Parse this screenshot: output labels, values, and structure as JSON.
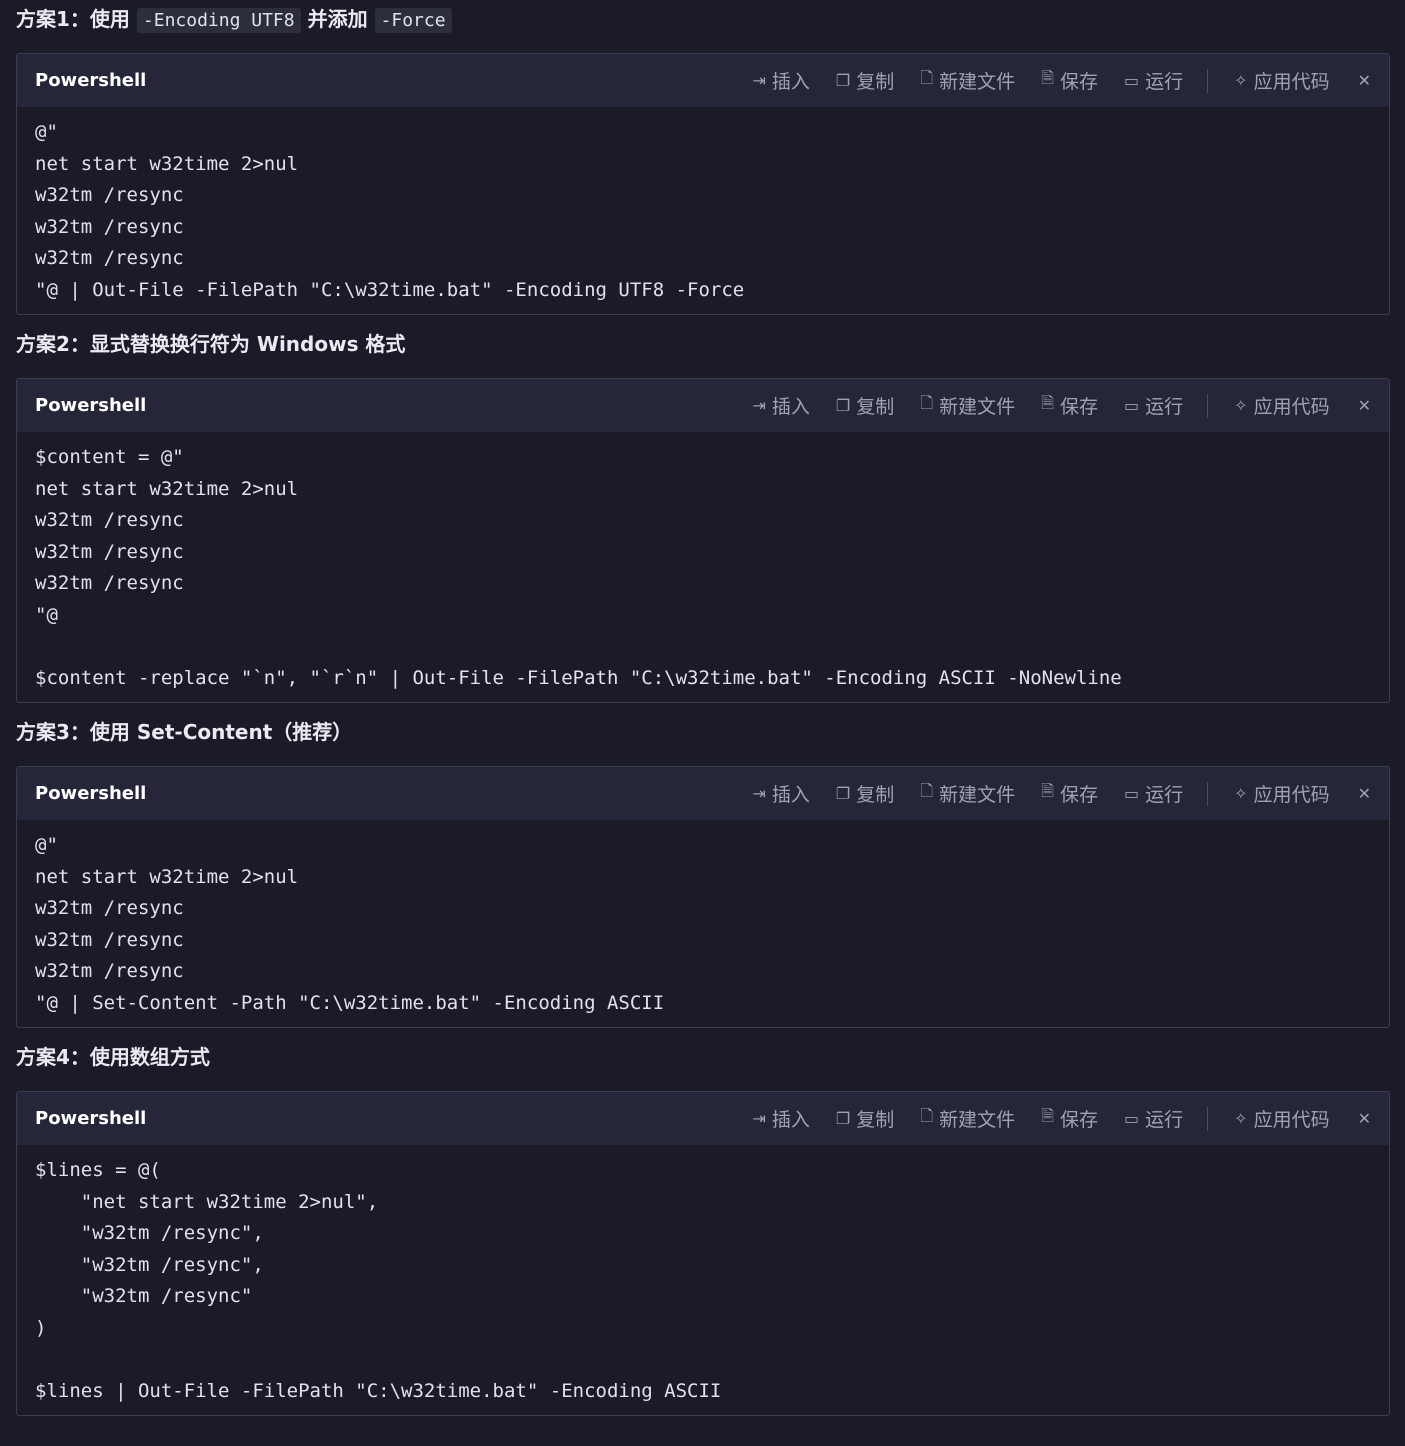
{
  "sections": [
    {
      "heading_parts": [
        {
          "t": "方案1：使用 ",
          "code": false
        },
        {
          "t": "-Encoding UTF8",
          "code": true
        },
        {
          "t": " 并添加 ",
          "code": false
        },
        {
          "t": "-Force",
          "code": true
        }
      ],
      "lang": "Powershell",
      "code": "@\"\nnet start w32time 2>nul\nw32tm /resync\nw32tm /resync\nw32tm /resync\n\"@ | Out-File -FilePath \"C:\\w32time.bat\" -Encoding UTF8 -Force"
    },
    {
      "heading_parts": [
        {
          "t": "方案2：显式替换换行符为 Windows 格式",
          "code": false
        }
      ],
      "lang": "Powershell",
      "code": "$content = @\"\nnet start w32time 2>nul\nw32tm /resync\nw32tm /resync\nw32tm /resync\n\"@\n\n$content -replace \"`n\", \"`r`n\" | Out-File -FilePath \"C:\\w32time.bat\" -Encoding ASCII -NoNewline"
    },
    {
      "heading_parts": [
        {
          "t": "方案3：使用 Set-Content（推荐）",
          "code": false
        }
      ],
      "lang": "Powershell",
      "code": "@\"\nnet start w32time 2>nul\nw32tm /resync\nw32tm /resync\nw32tm /resync\n\"@ | Set-Content -Path \"C:\\w32time.bat\" -Encoding ASCII"
    },
    {
      "heading_parts": [
        {
          "t": "方案4：使用数组方式",
          "code": false
        }
      ],
      "lang": "Powershell",
      "code": "$lines = @(\n    \"net start w32time 2>nul\",\n    \"w32tm /resync\",\n    \"w32tm /resync\",\n    \"w32tm /resync\"\n)\n\n$lines | Out-File -FilePath \"C:\\w32time.bat\" -Encoding ASCII"
    }
  ],
  "toolbar": {
    "insert": {
      "label": "插入",
      "icon": "insert-icon"
    },
    "copy": {
      "label": "复制",
      "icon": "copy-icon"
    },
    "new_file": {
      "label": "新建文件",
      "icon": "new-file-icon"
    },
    "save": {
      "label": "保存",
      "icon": "save-icon"
    },
    "run": {
      "label": "运行",
      "icon": "terminal-icon"
    },
    "apply": {
      "label": "应用代码",
      "icon": "sparkle-icon"
    },
    "collapse": {
      "icon": "collapse-icon"
    }
  },
  "colors": {
    "background": "#1b1b27",
    "header_bg": "#25263a",
    "border": "#3a3d4c",
    "text": "#dfe2ec",
    "muted": "#9ea2b3"
  }
}
